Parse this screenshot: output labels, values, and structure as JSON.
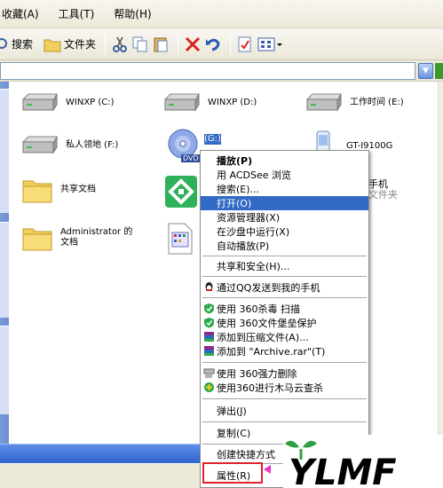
{
  "menubar": {
    "items": [
      "收藏(A)",
      "工具(T)",
      "帮助(H)"
    ]
  },
  "toolbar": {
    "search_label": "搜索",
    "folders_label": "文件夹"
  },
  "address": {
    "value": "",
    "dropdown_icon": "chevron-down-icon",
    "go_icon": "go-arrow-icon"
  },
  "content": {
    "items": [
      {
        "label": "WINXP (C:)",
        "icon": "hard-drive-icon"
      },
      {
        "label": "WINXP (D:)",
        "icon": "hard-drive-icon"
      },
      {
        "label": "工作时间 (E:)",
        "icon": "hard-drive-icon"
      },
      {
        "label": "私人领地 (F:)",
        "icon": "hard-drive-icon"
      },
      {
        "label": "(G:)",
        "icon": "dvd-drive-icon"
      },
      {
        "label": "GT-I9100G",
        "icon": "phone-icon"
      },
      {
        "label": "共享文档",
        "icon": "folder-icon"
      },
      {
        "label": "手机",
        "icon": "app-icon"
      },
      {
        "label": "文件夹",
        "icon": "app-icon"
      },
      {
        "label": "Administrator 的文档",
        "icon": "folder-icon"
      },
      {
        "label": "",
        "icon": "document-icon"
      }
    ],
    "dvd_badge": "DVD"
  },
  "context_menu": {
    "items": [
      {
        "label": "播放(P)",
        "bold": true
      },
      {
        "label": "用 ACDSee 浏览"
      },
      {
        "label": "搜索(E)..."
      },
      {
        "label": "打开(O)",
        "highlighted": true
      },
      {
        "label": "资源管理器(X)"
      },
      {
        "label": "在沙盘中运行(X)"
      },
      {
        "label": "自动播放(P)"
      },
      {
        "label": "共享和安全(H)..."
      },
      {
        "label": "通过QQ发送到我的手机",
        "icon": "qq-icon"
      },
      {
        "label": "使用 360杀毒 扫描",
        "icon": "shield-icon"
      },
      {
        "label": "使用 360文件堡垒保护",
        "icon": "shield-icon"
      },
      {
        "label": "添加到压缩文件(A)...",
        "icon": "archive-icon"
      },
      {
        "label": "添加到 \"Archive.rar\"(T)",
        "icon": "archive-icon"
      },
      {
        "label": "使用 360强力删除",
        "icon": "shredder-icon"
      },
      {
        "label": "使用360进行木马云查杀",
        "icon": "plus-shield-icon"
      },
      {
        "label": "弹出(J)"
      },
      {
        "label": "复制(C)"
      },
      {
        "label": "创建快捷方式"
      },
      {
        "label": "属性(R)"
      }
    ]
  },
  "logo": {
    "text": "YLMF",
    "colors": {
      "leaf": "#2ea043",
      "text": "#000000"
    }
  },
  "colors": {
    "highlight": "#316ac5",
    "annotation_outline": "#e0202a",
    "annotation_arrow": "#e636c8"
  }
}
